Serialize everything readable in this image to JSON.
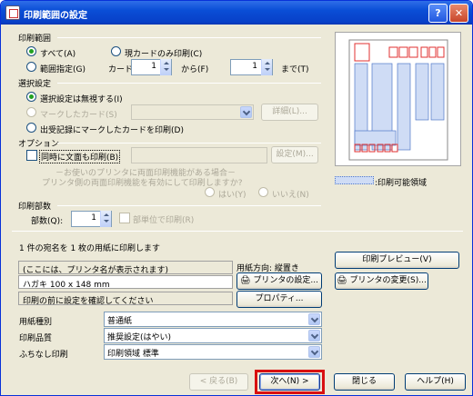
{
  "window": {
    "title": "印刷範囲の設定",
    "help_btn": "?",
    "close_btn": "✕"
  },
  "print_range": {
    "label": "印刷範囲",
    "all": "すべて(A)",
    "current_card": "現カードのみ印刷(C)",
    "range": "範囲指定(G)",
    "card_label": "カード",
    "card_from": "1",
    "from_label": "から(F)",
    "card_to": "1",
    "to_label": "まで(T)"
  },
  "selection": {
    "label": "選択設定",
    "ignore": "選択設定は無視する(I)",
    "marked": "マークしたカード(S)",
    "detail_btn": "詳細(L)...",
    "shipping": "出受記録にマークしたカードを印刷(D)"
  },
  "options": {
    "label": "オプション",
    "duplex": "同時に文面も印刷(B)",
    "settings_btn": "設定(M)...",
    "note_line1": "－お使いのプリンタに両面印刷機能がある場合－",
    "note_line2": "プリンタ側の両面印刷機能を有効にして印刷しますか?",
    "yes": "はい(Y)",
    "no": "いいえ(N)"
  },
  "copies": {
    "label": "印刷部数",
    "count_label": "部数(Q):",
    "count_value": "1",
    "collate": "部単位で印刷(R)"
  },
  "summary": "1 件の宛名を 1 枚の用紙に印刷します",
  "printer": {
    "name": "(ここには、プリンタ名が表示されます)",
    "paper": "ハガキ 100 x 148 mm",
    "check": "印刷の前に設定を確認してください",
    "orientation": "用紙方向: 縦置き",
    "printer_settings_btn": "プリンタの設定...",
    "properties_btn": "プロパティ...",
    "preview_btn": "印刷プレビュー(V)",
    "change_printer_btn": "プリンタの変更(S)..."
  },
  "legend_text": ":印刷可能領域",
  "paper_settings": [
    {
      "label": "用紙種別",
      "value": "普通紙"
    },
    {
      "label": "印刷品質",
      "value": "推奨設定(はやい)"
    },
    {
      "label": "ふちなし印刷",
      "value": "印刷領域 標準"
    }
  ],
  "footer": {
    "back": "< 戻る(B)",
    "next": "次へ(N) >",
    "close": "閉じる",
    "help": "ヘルプ(H)"
  },
  "colors": {
    "highlight": "#d81010",
    "title": "#0a4ed6",
    "postal": "#e03030",
    "print_area": "#5078c8"
  }
}
